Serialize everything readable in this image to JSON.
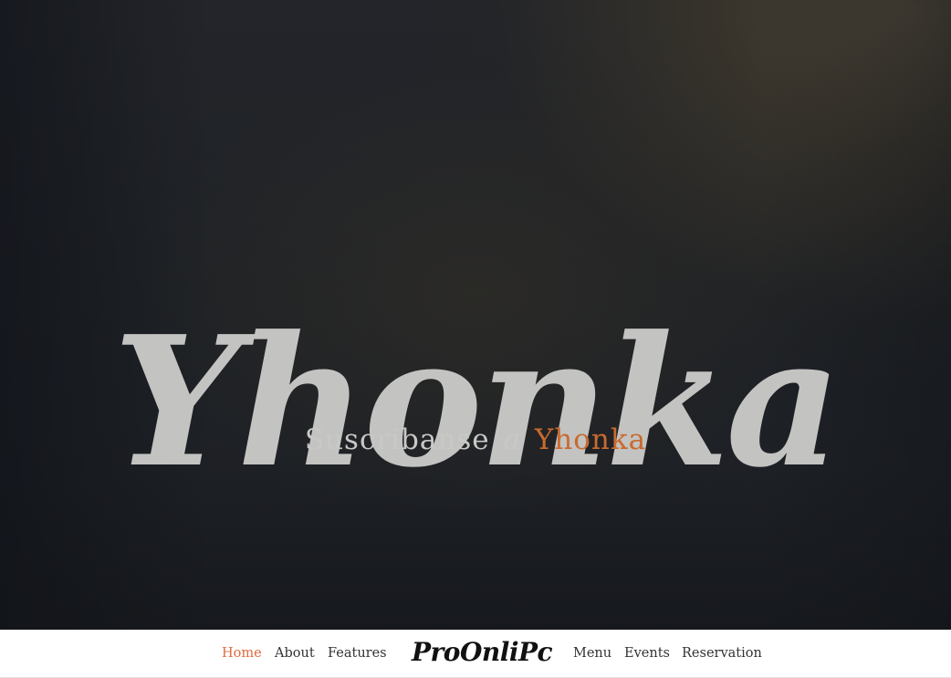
{
  "hero": {
    "title": "Yhonka",
    "tagline": {
      "prefix": "Suscribanse",
      "conjunction": "a",
      "highlight": "Yhonka"
    }
  },
  "navbar": {
    "logo": "ProOnliPc",
    "left_links": [
      {
        "label": "Home",
        "active": true
      },
      {
        "label": "About",
        "active": false
      },
      {
        "label": "Features",
        "active": false
      }
    ],
    "right_links": [
      {
        "label": "Menu",
        "active": false
      },
      {
        "label": "Events",
        "active": false
      },
      {
        "label": "Reservation",
        "active": false
      }
    ]
  },
  "colors": {
    "accent": "#c86a2f",
    "nav_active": "#e06a40",
    "hero_text": "#c3c3c1"
  }
}
